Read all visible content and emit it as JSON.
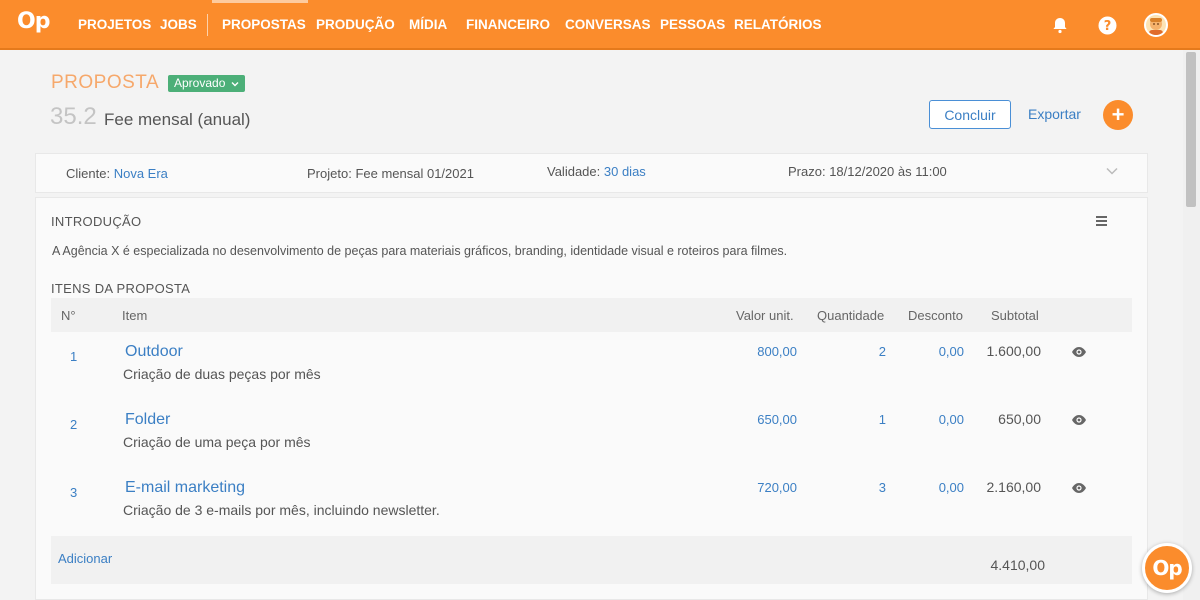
{
  "app": {
    "logo": "Op",
    "accent": "#fb8c2c"
  },
  "nav": {
    "items": [
      "PROJETOS",
      "JOBS",
      "PROPOSTAS",
      "PRODUÇÃO",
      "MÍDIA",
      "FINANCEIRO",
      "CONVERSAS",
      "PESSOAS",
      "RELATÓRIOS"
    ],
    "active": "PROPOSTAS",
    "icons": [
      "bell-icon",
      "help-icon",
      "avatar"
    ]
  },
  "header": {
    "doc_type": "PROPOSTA",
    "status": "Aprovado",
    "number": "35.2",
    "title": "Fee mensal (anual)",
    "concluir_label": "Concluir",
    "exportar_label": "Exportar",
    "add_label": "+"
  },
  "info": {
    "cliente_label": "Cliente:",
    "cliente_value": "Nova Era",
    "projeto_label": "Projeto:",
    "projeto_value": "Fee mensal 01/2021",
    "validade_label": "Validade:",
    "validade_value": "30 dias",
    "prazo_label": "Prazo:",
    "prazo_value": "18/12/2020 às 11:00"
  },
  "intro": {
    "title": "INTRODUÇÃO",
    "text": "A Agência X é especializada no desenvolvimento de peças para materiais gráficos, branding, identidade visual e roteiros para filmes."
  },
  "items": {
    "title": "ITENS DA PROPOSTA",
    "columns": [
      "N°",
      "Item",
      "Valor unit.",
      "Quantidade",
      "Desconto",
      "Subtotal"
    ],
    "rows": [
      {
        "n": "1",
        "name": "Outdoor",
        "desc": "Criação de duas peças por mês",
        "unit": "800,00",
        "qty": "2",
        "disc": "0,00",
        "subtotal": "1.600,00"
      },
      {
        "n": "2",
        "name": "Folder",
        "desc": "Criação de uma peça por mês",
        "unit": "650,00",
        "qty": "1",
        "disc": "0,00",
        "subtotal": "650,00"
      },
      {
        "n": "3",
        "name": "E-mail marketing",
        "desc": "Criação de 3 e-mails por mês, incluindo newsletter.",
        "unit": "720,00",
        "qty": "3",
        "disc": "0,00",
        "subtotal": "2.160,00"
      }
    ],
    "add_label": "Adicionar",
    "total": "4.410,00"
  },
  "fab": {
    "label": "Op"
  }
}
